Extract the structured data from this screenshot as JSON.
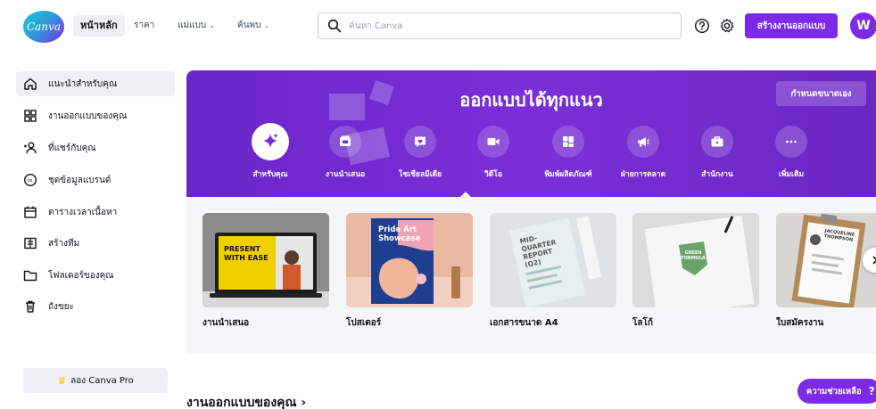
{
  "topbar": {
    "logo_text": "Canva",
    "nav": {
      "home": "หน้าหลัก",
      "pricing": "ราคา",
      "templates": "แม่แบบ",
      "discover": "ค้นพบ"
    },
    "search_placeholder": "ค้นหา Canva",
    "create_button": "สร้างงานออกแบบ",
    "avatar_letter": "W"
  },
  "sidebar": {
    "items": [
      {
        "label": "แนะนำสำหรับคุณ",
        "icon": "home-icon",
        "active": true
      },
      {
        "label": "งานออกแบบของคุณ",
        "icon": "grid-icon",
        "active": false
      },
      {
        "label": "ที่แชร์กับคุณ",
        "icon": "people-icon",
        "active": false
      },
      {
        "label": "ชุดข้อมูลแบรนด์",
        "icon": "brand-icon",
        "active": false
      },
      {
        "label": "ตารางเวลาเนื้อหา",
        "icon": "calendar-icon",
        "active": false
      },
      {
        "label": "สร้างทีม",
        "icon": "team-icon",
        "active": false
      },
      {
        "label": "โฟลเดอร์ของคุณ",
        "icon": "folder-icon",
        "active": false
      },
      {
        "label": "ถังขยะ",
        "icon": "trash-icon",
        "active": false
      }
    ],
    "pro_button": "ลอง Canva Pro"
  },
  "hero": {
    "title": "ออกแบบได้ทุกแนว",
    "custom_size_button": "กำหนดขนาดเอง",
    "categories": [
      {
        "label": "สำหรับคุณ",
        "icon": "sparkle-icon",
        "selected": true
      },
      {
        "label": "งานนำเสนอ",
        "icon": "presentation-icon",
        "selected": false
      },
      {
        "label": "โซเชียลมีเดีย",
        "icon": "heart-chat-icon",
        "selected": false
      },
      {
        "label": "วิดีโอ",
        "icon": "video-icon",
        "selected": false
      },
      {
        "label": "พิมพ์ผลิตภัณฑ์",
        "icon": "print-icon",
        "selected": false
      },
      {
        "label": "ฝ่ายการตลาด",
        "icon": "megaphone-icon",
        "selected": false
      },
      {
        "label": "สำนักงาน",
        "icon": "briefcase-icon",
        "selected": false
      },
      {
        "label": "เพิ่มเติม",
        "icon": "more-icon",
        "selected": false
      }
    ]
  },
  "templates": [
    {
      "label": "งานนำเสนอ",
      "thumb_text": "PRESENT WITH EASE"
    },
    {
      "label": "โปสเตอร์",
      "thumb_text": "Pride Art Showcase"
    },
    {
      "label": "เอกสารขนาด A4",
      "thumb_text": "MID-QUARTER REPORT (Q2)"
    },
    {
      "label": "โลโก้",
      "thumb_text": "GREEN FORMULA"
    },
    {
      "label": "ใบสมัครงาน",
      "thumb_text": "JACQUELINE THOMPSON"
    }
  ],
  "section_title": "งานออกแบบของคุณ ›",
  "help_button": "ความช่วยเหลือ",
  "help_symbol": "?",
  "colors": {
    "accent": "#7d2ae8",
    "hero_bg": "#7a2fd8",
    "strip_bg": "#f5f6f7"
  }
}
